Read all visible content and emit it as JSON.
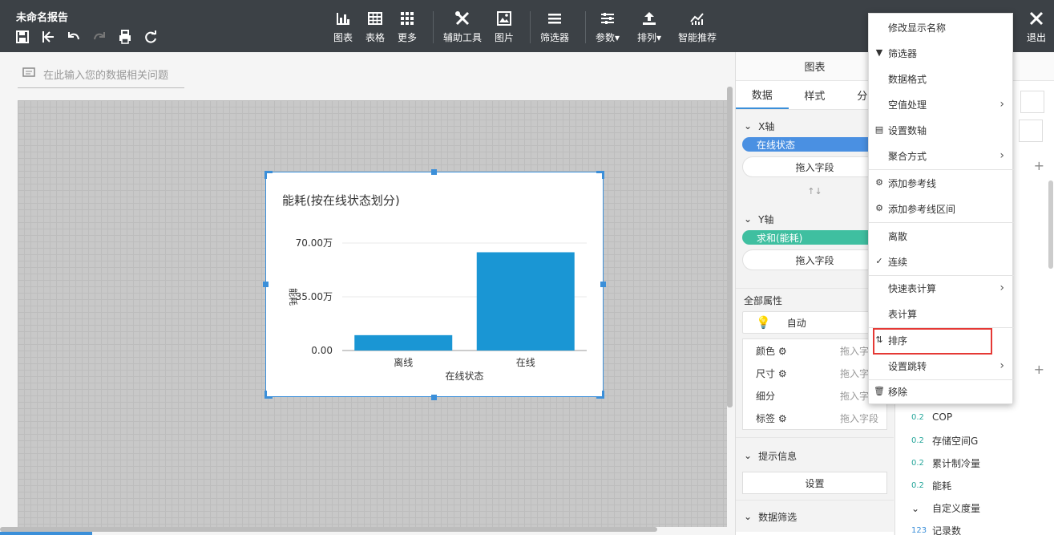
{
  "app": {
    "title": "未命名报告"
  },
  "toolbar": {
    "buttons": [
      {
        "label": "图表",
        "icon": "bar-chart-icon"
      },
      {
        "label": "表格",
        "icon": "table-icon"
      },
      {
        "label": "更多",
        "icon": "grid-more-icon"
      },
      {
        "label": "辅助工具",
        "icon": "tools-icon"
      },
      {
        "label": "图片",
        "icon": "image-icon"
      },
      {
        "label": "筛选器",
        "icon": "filter-list-icon"
      },
      {
        "label": "参数▾",
        "icon": "params-icon"
      },
      {
        "label": "排列▾",
        "icon": "arrange-icon"
      },
      {
        "label": "智能推荐",
        "icon": "smart-recommend-icon"
      }
    ],
    "exit_label": "退出"
  },
  "question": {
    "placeholder": "在此输入您的数据相关问题"
  },
  "chart_data": {
    "type": "bar",
    "title": "能耗(按在线状态划分)",
    "categories": [
      "离线",
      "在线"
    ],
    "values": [
      100000,
      640000
    ],
    "ylabel": "能耗",
    "xlabel": "在线状态",
    "ylim": [
      0,
      700000
    ],
    "yticks": [
      {
        "value": 0,
        "label": "0.00"
      },
      {
        "value": 350000,
        "label": "35.00万"
      },
      {
        "value": 700000,
        "label": "70.00万"
      }
    ],
    "grid": true,
    "color": "#1a96d4"
  },
  "panel": {
    "header": "图表",
    "tabs": [
      "数据",
      "样式",
      "分"
    ],
    "x_axis": {
      "title": "X轴",
      "field": "在线状态",
      "drop": "拖入字段"
    },
    "swap_icon": "↑↓",
    "y_axis": {
      "title": "Y轴",
      "field": "求和(能耗)",
      "drop": "拖入字段"
    },
    "all_props": {
      "title": "全部属性",
      "mode": "自动",
      "rows": [
        {
          "label": "颜色",
          "hint": "拖入字段"
        },
        {
          "label": "尺寸",
          "hint": "拖入字段"
        },
        {
          "label": "细分",
          "hint": "拖入字段"
        },
        {
          "label": "标签",
          "hint": "拖入字段"
        }
      ]
    },
    "tooltip": {
      "title": "提示信息",
      "button": "设置"
    },
    "data_filter": {
      "title": "数据筛选"
    }
  },
  "fields": [
    {
      "type": "0.2",
      "name": "COP"
    },
    {
      "type": "0.2",
      "name": "存储空间G"
    },
    {
      "type": "0.2",
      "name": "累计制冷量"
    },
    {
      "type": "0.2",
      "name": "能耗"
    },
    {
      "type": "⌄",
      "name": "自定义度量"
    },
    {
      "type": "123",
      "name": "记录数"
    }
  ],
  "menu": {
    "items": [
      {
        "label": "修改显示名称"
      },
      {
        "label": "筛选器",
        "icon": "filter-icon"
      },
      {
        "label": "数据格式"
      },
      {
        "label": "空值处理",
        "submenu": true
      },
      {
        "label": "设置数轴",
        "icon": "axis-icon"
      },
      {
        "label": "聚合方式",
        "submenu": true
      },
      {
        "label": "添加参考线",
        "icon": "gear-icon"
      },
      {
        "label": "添加参考线区间",
        "icon": "gear-icon"
      },
      {
        "label": "离散"
      },
      {
        "label": "连续",
        "icon": "check-icon"
      },
      {
        "label": "快速表计算",
        "submenu": true
      },
      {
        "label": "表计算"
      },
      {
        "label": "排序",
        "icon": "sort-icon"
      },
      {
        "label": "设置跳转",
        "submenu": true
      },
      {
        "label": "移除",
        "icon": "trash-icon"
      }
    ]
  },
  "colors": {
    "toolbar": "#3c4146",
    "accent": "#3b8fd9",
    "pill_x": "#4a90e2",
    "pill_y": "#3fbfa0",
    "highlight": "#e53935"
  }
}
